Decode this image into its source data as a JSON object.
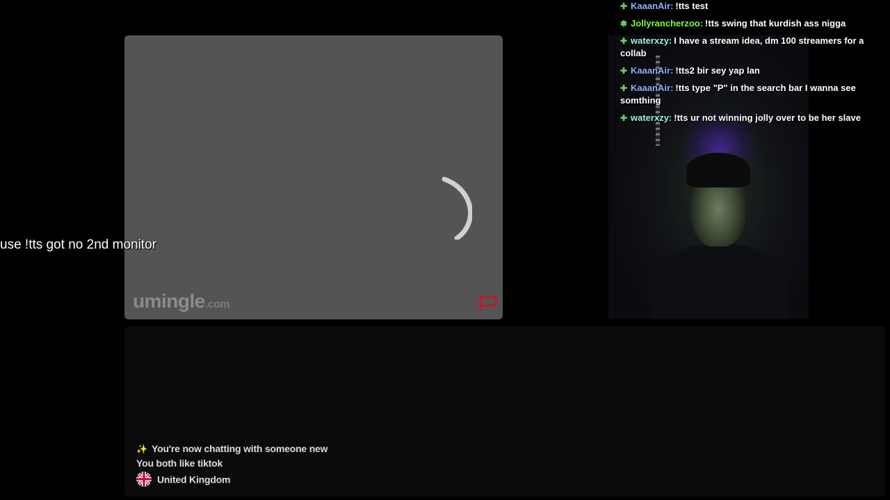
{
  "app": {
    "logo_text": "umingle",
    "logo_suffix": ".com"
  },
  "overlay": {
    "caption": "use !tts got no 2nd monitor"
  },
  "chat": {
    "messages": [
      {
        "badge": "✚",
        "name": "KaaanAir:",
        "name_color": "#8fb3ff",
        "text": "!tts test"
      },
      {
        "badge": "✽",
        "name": "Jollyrancherzoo:",
        "name_color": "#7fff3a",
        "text": "!tts swing that kurdish ass nigga"
      },
      {
        "badge": "✚",
        "name": "waterxzy:",
        "name_color": "#9ff5e0",
        "text": "I have a stream idea, dm 100 streamers for a collab"
      },
      {
        "badge": "✚",
        "name": "KaaanAir:",
        "name_color": "#8fb3ff",
        "text": "!tts2 bir sey yap lan"
      },
      {
        "badge": "✚",
        "name": "KaaanAir:",
        "name_color": "#8fb3ff",
        "text": "!tts type \"P\" in the search bar I wanna see somthing"
      },
      {
        "badge": "✚",
        "name": "waterxzy:",
        "name_color": "#9ff5e0",
        "text": "!tts ur not winning jolly over to be her slave"
      }
    ]
  },
  "system": {
    "new_chat": "You're now chatting with someone new",
    "common_interest": "You both like tiktok",
    "country": "United Kingdom"
  },
  "icons": {
    "spinner": "loading-spinner-icon",
    "report": "flag-report-icon",
    "sparkle": "sparkle-icon",
    "country_flag": "uk-flag-icon"
  },
  "colors": {
    "panel": "#545454",
    "report": "#c0172a",
    "badge": "#5ed35e"
  }
}
